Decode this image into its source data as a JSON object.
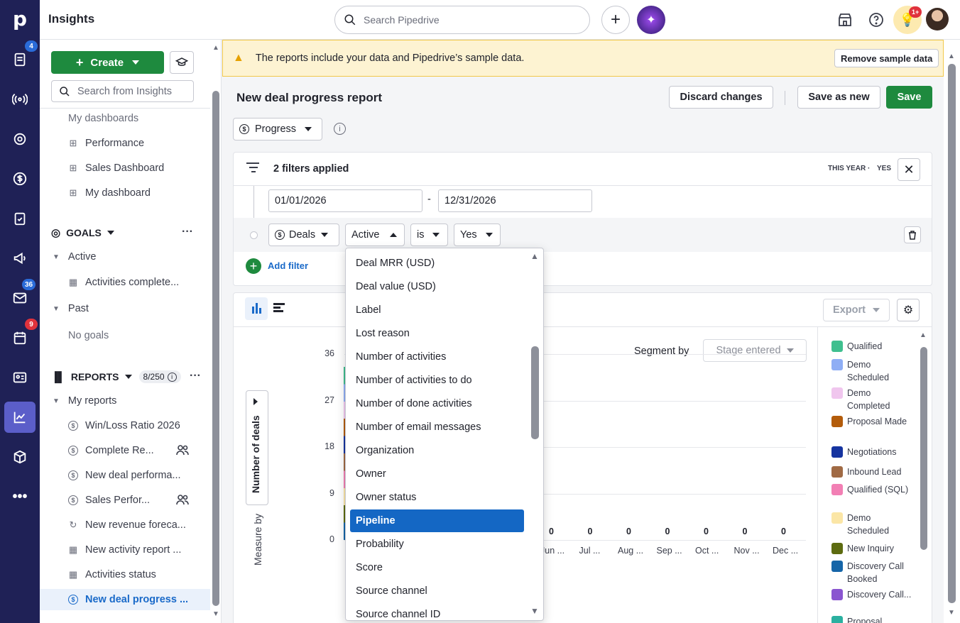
{
  "app": {
    "section_title": "Insights"
  },
  "rail": {
    "badges": {
      "leads": "4",
      "mail": "36",
      "calendar": "9"
    }
  },
  "topbar": {
    "search_placeholder": "Search Pipedrive",
    "notif_badge": "1+"
  },
  "sidebar": {
    "create_label": "Create",
    "search_placeholder": "Search from Insights",
    "dashboards_partial": "My dashboards",
    "dashboards": [
      "Performance",
      "Sales Dashboard",
      "My dashboard"
    ],
    "goals": {
      "title": "GOALS",
      "active_label": "Active",
      "active_items": [
        "Activities complete..."
      ],
      "past_label": "Past",
      "no_goals": "No goals"
    },
    "reports": {
      "title": "REPORTS",
      "count": "8/250",
      "my_reports_label": "My reports",
      "items": [
        {
          "label": "Win/Loss Ratio 2026",
          "icon": "dollar-icon",
          "shared": false
        },
        {
          "label": "Complete Re...",
          "icon": "dollar-icon",
          "shared": true
        },
        {
          "label": "New deal performa...",
          "icon": "dollar-icon",
          "shared": false
        },
        {
          "label": "Sales Perfor...",
          "icon": "dollar-icon",
          "shared": true
        },
        {
          "label": "New revenue foreca...",
          "icon": "forecast-icon",
          "shared": false
        },
        {
          "label": "New activity report ...",
          "icon": "calendar-icon",
          "shared": false
        },
        {
          "label": "Activities status",
          "icon": "calendar-icon",
          "shared": false
        },
        {
          "label": "New deal progress ...",
          "icon": "dollar-icon",
          "shared": false
        }
      ]
    }
  },
  "banner": {
    "text": "The reports include your data and Pipedrive’s sample data.",
    "button": "Remove sample data",
    "color": "#fdf3d2"
  },
  "report": {
    "title": "New deal progress report",
    "discard": "Discard changes",
    "save_as_new": "Save as new",
    "save": "Save",
    "type_label": "Progress"
  },
  "filters": {
    "summary": "2 filters applied",
    "tag_period": "THIS YEAR",
    "tag_value": "YES",
    "date_from": "01/01/2026",
    "date_to": "12/31/2026",
    "date_sep": "-",
    "entity": "Deals",
    "field": "Active",
    "operator": "is",
    "value": "Yes",
    "add_filter": "Add filter"
  },
  "dropdown": {
    "items": [
      "Deal MRR (USD)",
      "Deal value (USD)",
      "Label",
      "Lost reason",
      "Number of activities",
      "Number of activities to do",
      "Number of done activities",
      "Number of email messages",
      "Organization",
      "Owner",
      "Owner status",
      "Pipeline",
      "Probability",
      "Score",
      "Source channel",
      "Source channel ID"
    ],
    "selected": "Pipeline"
  },
  "chart_panel": {
    "export": "Export",
    "segment_by_label": "Segment by",
    "segment_by_value": "Stage entered",
    "measure_by_label": "Measure by",
    "measure_value": "Number of deals"
  },
  "chart_data": {
    "type": "bar",
    "ylabel": "Number of deals",
    "yticks": [
      0,
      9,
      18,
      27,
      36
    ],
    "ylim": [
      0,
      36
    ],
    "categories_visible": [
      "Jun ...",
      "Jul ...",
      "Aug ...",
      "Sep ...",
      "Oct ...",
      "Nov ...",
      "Dec ..."
    ],
    "values_visible": [
      0,
      0,
      0,
      0,
      0,
      0,
      0
    ],
    "legend": [
      {
        "name": "Qualified",
        "color": "#3fbf8f"
      },
      {
        "name": "Demo Scheduled",
        "color": "#8faef5"
      },
      {
        "name": "Demo Completed",
        "color": "#f0c6ee"
      },
      {
        "name": "Proposal Made",
        "color": "#b35c0b"
      },
      {
        "name": "Negotiations",
        "color": "#1634a0"
      },
      {
        "name": "Inbound Lead",
        "color": "#a06a44"
      },
      {
        "name": "Qualified (SQL)",
        "color": "#f27fb4"
      },
      {
        "name": "Demo Scheduled",
        "color": "#fbe6a6"
      },
      {
        "name": "New Inquiry",
        "color": "#5d6b10"
      },
      {
        "name": "Discovery Call Booked",
        "color": "#1565a8"
      },
      {
        "name": "Discovery Call...",
        "color": "#8a55d0"
      },
      {
        "name": "Proposal...",
        "color": "#2bb0a0"
      }
    ]
  }
}
